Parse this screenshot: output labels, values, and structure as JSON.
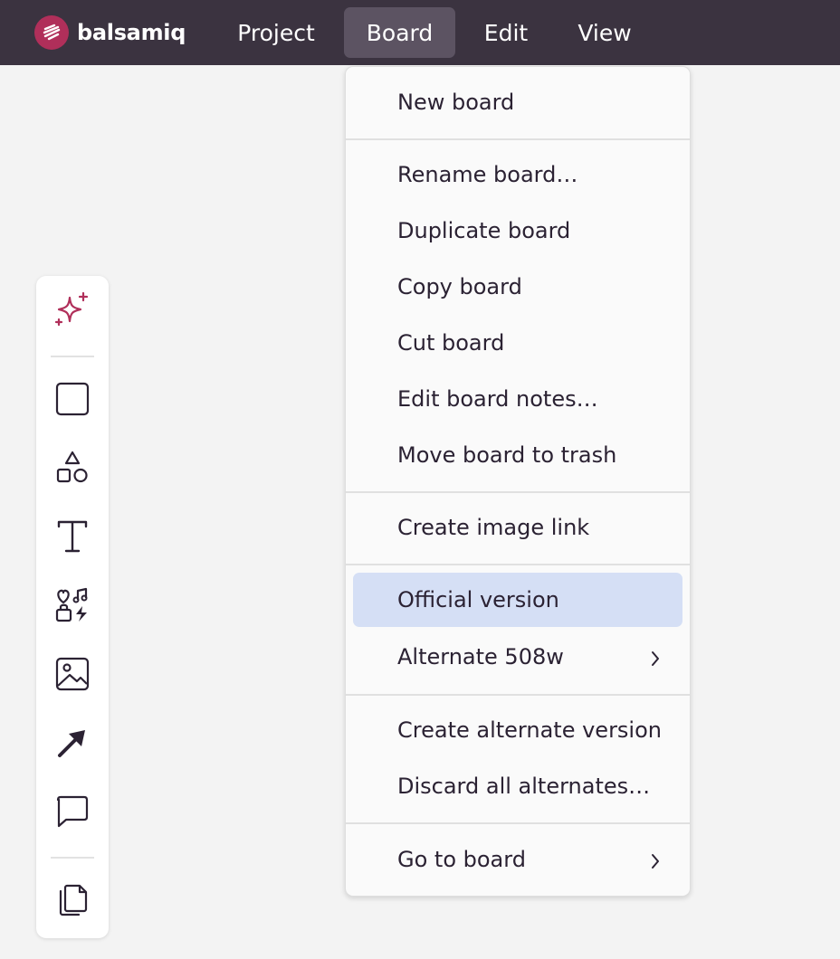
{
  "app": {
    "name": "balsamiq",
    "brand_color": "#b02f5a"
  },
  "menubar": {
    "items": [
      {
        "label": "Project"
      },
      {
        "label": "Board"
      },
      {
        "label": "Edit"
      },
      {
        "label": "View"
      }
    ],
    "active": "Board"
  },
  "board_menu": {
    "items": [
      {
        "label": "New board"
      },
      {
        "label": "Rename board…"
      },
      {
        "label": "Duplicate board"
      },
      {
        "label": "Copy board"
      },
      {
        "label": "Cut board"
      },
      {
        "label": "Edit board notes…"
      },
      {
        "label": "Move board to trash"
      },
      {
        "label": "Create image link"
      },
      {
        "label": "Official version"
      },
      {
        "label": "Alternate 508w"
      },
      {
        "label": "Create alternate version"
      },
      {
        "label": "Discard all alternates…"
      },
      {
        "label": "Go to board"
      }
    ],
    "highlighted": "Official version",
    "highlight_color": "#d5dff5"
  },
  "toolbar": {
    "tools": [
      "sparkle-icon",
      "square-icon",
      "shapes-icon",
      "text-icon",
      "icons-library-icon",
      "image-icon",
      "arrow-icon",
      "comment-icon",
      "copy-pages-icon"
    ]
  }
}
